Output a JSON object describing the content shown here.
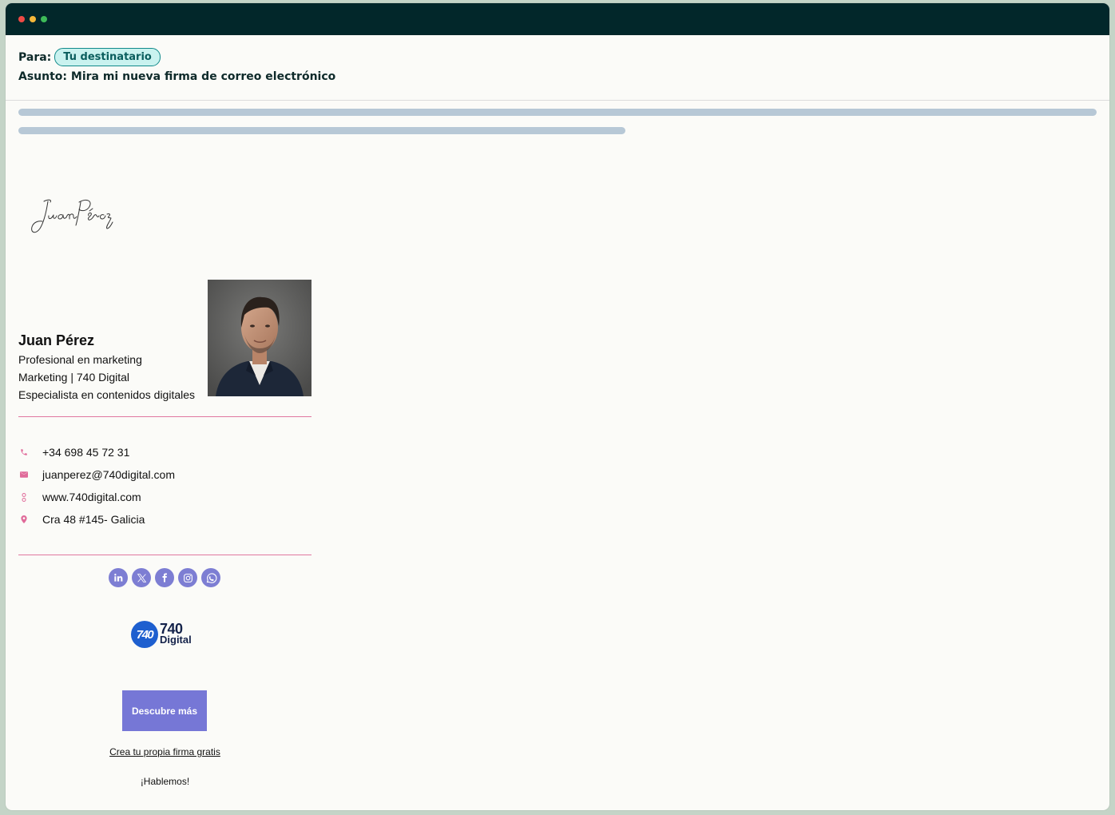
{
  "window": {
    "controls": [
      "close",
      "minimize",
      "maximize"
    ]
  },
  "email": {
    "to_label": "Para:",
    "recipient": "Tu destinatario",
    "subject_label": "Asunto:",
    "subject": "Mira mi nueva firma de correo electrónico"
  },
  "signature": {
    "script_name": "Juan Pérez",
    "name": "Juan Pérez",
    "lines": [
      "Profesional en marketing",
      "Marketing | 740 Digital",
      "Especialista en contenidos digitales"
    ],
    "contacts": [
      {
        "icon": "phone-icon",
        "text": "+34 698 45 72 31"
      },
      {
        "icon": "mail-icon",
        "text": "juanperez@740digital.com"
      },
      {
        "icon": "link-icon",
        "text": "www.740digital.com"
      },
      {
        "icon": "location-icon",
        "text": "Cra 48 #145- Galicia"
      }
    ],
    "socials": [
      "linkedin-icon",
      "x-icon",
      "facebook-icon",
      "instagram-icon",
      "whatsapp-icon"
    ],
    "logo": {
      "mark": "740",
      "number": "740",
      "word": "Digital"
    },
    "cta_label": "Descubre más",
    "create_link": "Crea tu propia firma gratis",
    "closing": "¡Hablemos!"
  },
  "colors": {
    "titlebar": "#02272a",
    "accent_pink": "#e077a0",
    "social_purple": "#7d7ed3",
    "cta_purple": "#7677d6",
    "logo_blue": "#1e5fcf",
    "chip_bg": "#c9f2ef",
    "chip_border": "#118a8a"
  }
}
